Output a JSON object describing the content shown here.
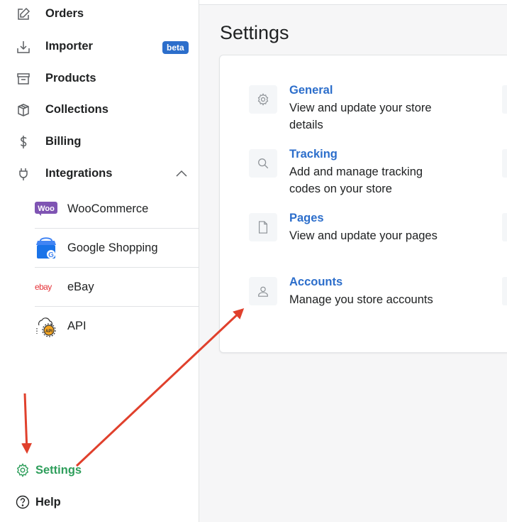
{
  "sidebar": {
    "items": [
      {
        "label": "Orders",
        "icon": "edit-icon"
      },
      {
        "label": "Importer",
        "icon": "download-icon",
        "badge": "beta"
      },
      {
        "label": "Products",
        "icon": "archive-icon"
      },
      {
        "label": "Collections",
        "icon": "box-icon"
      },
      {
        "label": "Billing",
        "icon": "dollar-icon"
      },
      {
        "label": "Integrations",
        "icon": "plug-icon"
      }
    ],
    "integrations": [
      {
        "label": "WooCommerce",
        "icon": "woocommerce-logo",
        "logo_text": "Woo"
      },
      {
        "label": "Google Shopping",
        "icon": "google-shopping-logo",
        "logo_text": "G"
      },
      {
        "label": "eBay",
        "icon": "ebay-logo",
        "logo_text": "ebay"
      },
      {
        "label": "API",
        "icon": "api-logo",
        "logo_text": "API"
      }
    ],
    "settings_label": "Settings",
    "help_label": "Help"
  },
  "main": {
    "title": "Settings",
    "settings": [
      {
        "title": "General",
        "desc": "View and update your store details",
        "icon": "gear-icon"
      },
      {
        "title": "Tracking",
        "desc": "Add and manage tracking codes on your store",
        "icon": "search-icon"
      },
      {
        "title": "Pages",
        "desc": "View and update your pages",
        "icon": "page-icon"
      },
      {
        "title": "Accounts",
        "desc": "Manage you store accounts",
        "icon": "user-icon"
      }
    ]
  },
  "colors": {
    "accent": "#2c6ecb",
    "active": "#2e9e5b",
    "annotation": "#e0402c"
  }
}
